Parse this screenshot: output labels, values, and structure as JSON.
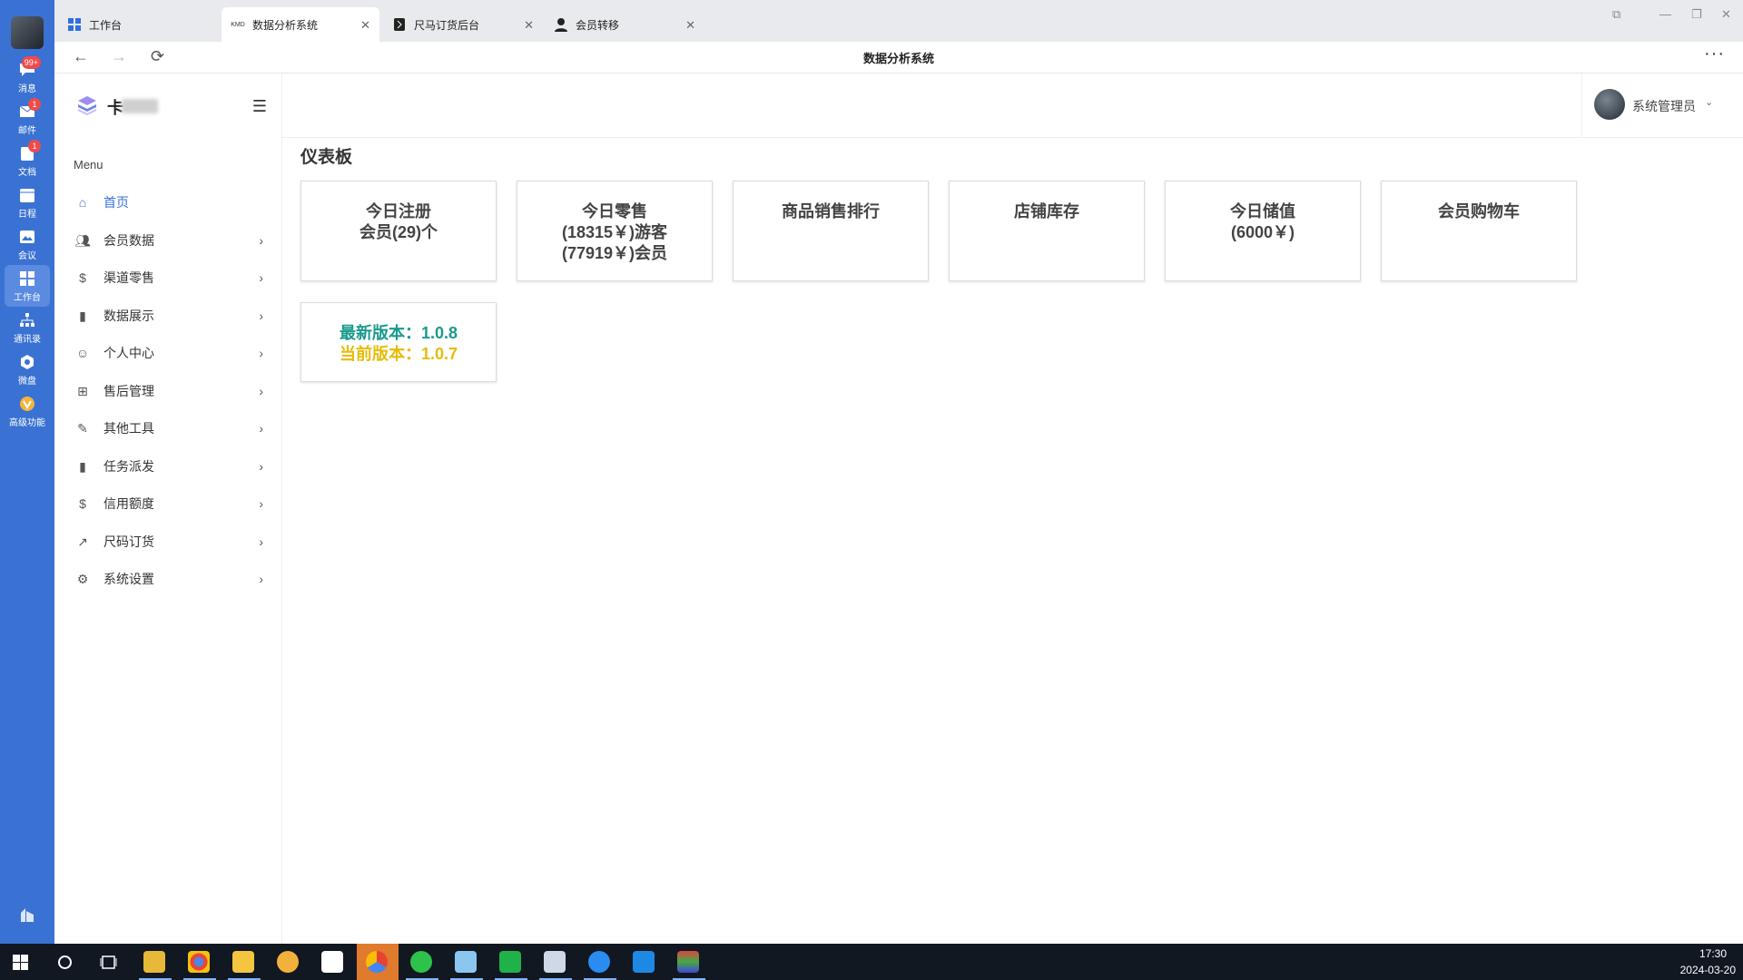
{
  "rail": {
    "items": [
      {
        "label": "消息",
        "badge": "99+",
        "icon": "chat-icon"
      },
      {
        "label": "邮件",
        "badge": "1",
        "icon": "mail-icon"
      },
      {
        "label": "文档",
        "badge": "1",
        "icon": "document-icon"
      },
      {
        "label": "日程",
        "badge": "",
        "icon": "calendar-icon"
      },
      {
        "label": "会议",
        "badge": "",
        "icon": "meeting-icon"
      },
      {
        "label": "工作台",
        "badge": "",
        "icon": "workbench-icon"
      },
      {
        "label": "通讯录",
        "badge": "",
        "icon": "contacts-icon"
      },
      {
        "label": "微盘",
        "badge": "",
        "icon": "cloud-disk-icon"
      },
      {
        "label": "高级功能",
        "badge": "",
        "icon": "premium-icon"
      }
    ]
  },
  "tabs": [
    {
      "label": "工作台",
      "icon": "grid-icon"
    },
    {
      "label": "数据分析系统",
      "icon": "kmd-icon"
    },
    {
      "label": "尺马订货后台",
      "icon": "ruler-icon"
    },
    {
      "label": "会员转移",
      "icon": "person-icon"
    }
  ],
  "navbar": {
    "title": "数据分析系统",
    "more": "···"
  },
  "sidebar": {
    "brand": "卡",
    "menu_title": "Menu",
    "items": [
      {
        "label": "首页",
        "icon": "home-icon"
      },
      {
        "label": "会员数据",
        "icon": "users-icon"
      },
      {
        "label": "渠道零售",
        "icon": "dollar-icon"
      },
      {
        "label": "数据展示",
        "icon": "bar-chart-icon"
      },
      {
        "label": "个人中心",
        "icon": "user-icon"
      },
      {
        "label": "售后管理",
        "icon": "plus-square-icon"
      },
      {
        "label": "其他工具",
        "icon": "wrench-icon"
      },
      {
        "label": "任务派发",
        "icon": "bar-chart-icon"
      },
      {
        "label": "信用额度",
        "icon": "dollar-icon"
      },
      {
        "label": "尺码订货",
        "icon": "external-link-icon"
      },
      {
        "label": "系统设置",
        "icon": "gear-icon"
      }
    ]
  },
  "header": {
    "user_name": "系统管理员"
  },
  "dashboard": {
    "title": "仪表板",
    "cards": [
      {
        "lines": [
          "今日注册",
          "会员(29)个"
        ]
      },
      {
        "lines": [
          "今日零售",
          "(18315￥)游客",
          "(77919￥)会员"
        ]
      },
      {
        "lines": [
          "商品销售排行"
        ]
      },
      {
        "lines": [
          "店铺库存"
        ]
      },
      {
        "lines": [
          "今日储值",
          "(6000￥)"
        ]
      },
      {
        "lines": [
          "会员购物车"
        ]
      }
    ],
    "version": {
      "latest": "最新版本：1.0.8",
      "current": "当前版本：1.0.7"
    }
  },
  "taskbar": {
    "time": "17:30",
    "date": "2024-03-20"
  },
  "colors": {
    "rail": "#3a72d3",
    "active_menu": "#3a6fd8",
    "latest_version": "#1a9a8c",
    "current_version": "#e5bc0a"
  }
}
